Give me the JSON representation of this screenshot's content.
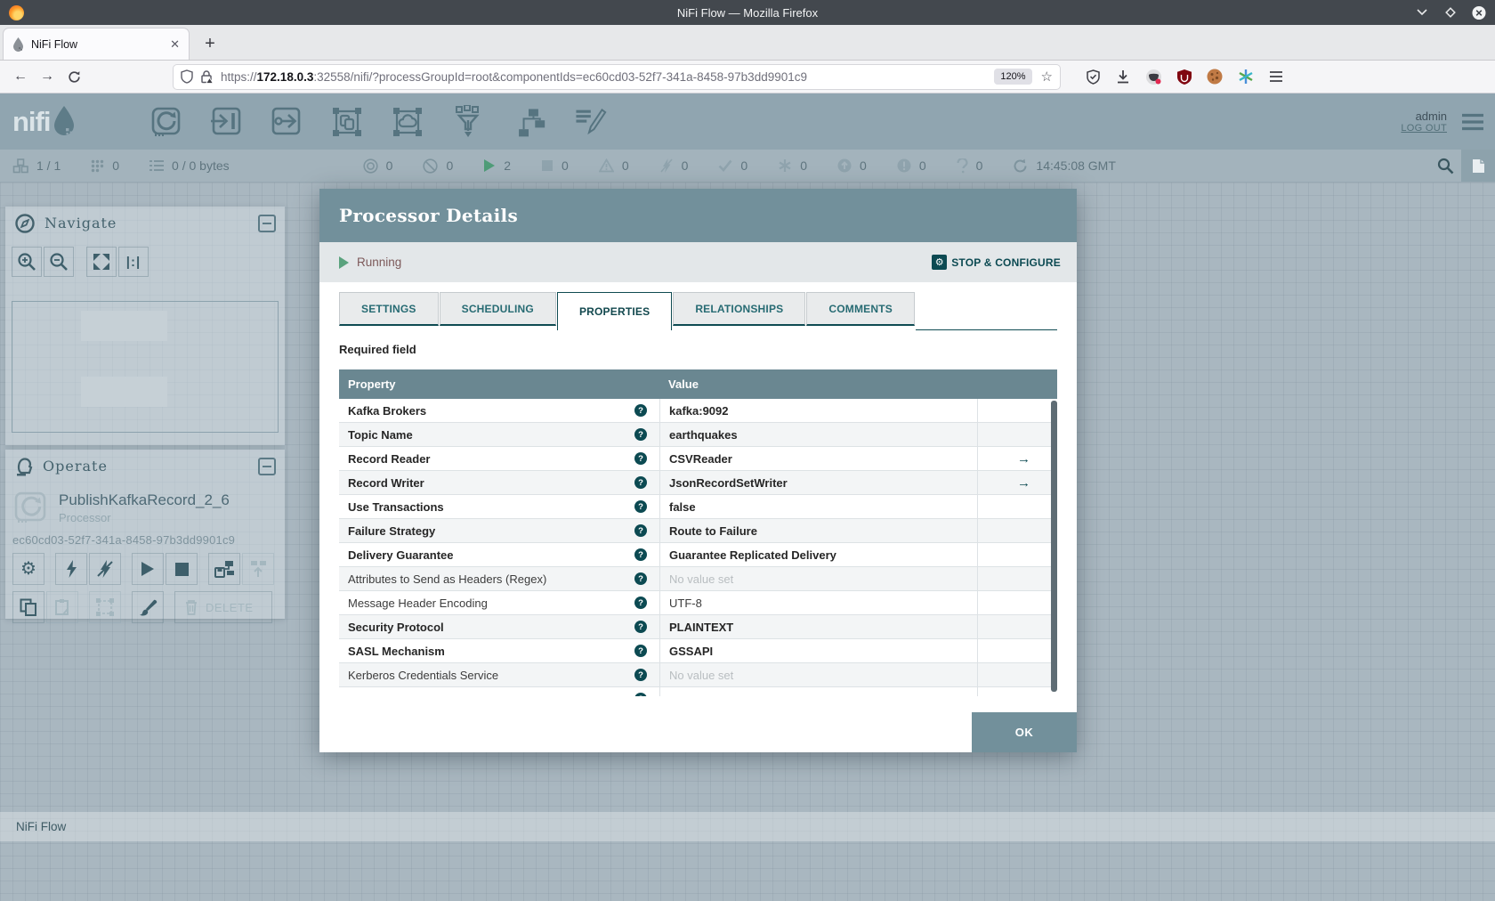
{
  "browser": {
    "window_title": "NiFi Flow — Mozilla Firefox",
    "tab_title": "NiFi Flow",
    "close_tab_glyph": "✕",
    "new_tab_glyph": "+",
    "back_glyph": "←",
    "forward_glyph": "→",
    "url_scheme": "https://",
    "url_host": "172.18.0.3",
    "url_rest": ":32558/nifi/?processGroupId=root&componentIds=ec60cd03-52f7-341a-8458-97b3dd9901c9",
    "zoom_badge": "120%",
    "star_glyph": "☆"
  },
  "app_header": {
    "logo_text": "nifi",
    "user": "admin",
    "logout_label": "LOG OUT"
  },
  "status_bar": {
    "items": [
      {
        "icon": "cluster-icon",
        "value": "1 / 1"
      },
      {
        "icon": "port-grid-icon",
        "value": "0"
      },
      {
        "icon": "queued-icon",
        "value": "0 / 0 bytes"
      },
      {
        "icon": "transmitting-icon",
        "value": "0"
      },
      {
        "icon": "not-transmitting-icon",
        "value": "0"
      },
      {
        "icon": "running-icon",
        "value": "2"
      },
      {
        "icon": "stopped-icon",
        "value": "0"
      },
      {
        "icon": "invalid-icon",
        "value": "0"
      },
      {
        "icon": "disabled-icon",
        "value": "0"
      },
      {
        "icon": "up-to-date-icon",
        "value": "0"
      },
      {
        "icon": "locally-modified-icon",
        "value": "0"
      },
      {
        "icon": "stale-icon",
        "value": "0"
      },
      {
        "icon": "locally-modified-stale-icon",
        "value": "0"
      },
      {
        "icon": "sync-failure-icon",
        "value": "0"
      }
    ],
    "refresh_time": "14:45:08 GMT"
  },
  "navigate_panel": {
    "title": "Navigate",
    "one_to_one_label": "|:|"
  },
  "operate_panel": {
    "title": "Operate",
    "component_name": "PublishKafkaRecord_2_6",
    "component_type": "Processor",
    "component_id": "ec60cd03-52f7-341a-8458-97b3dd9901c9",
    "gear_glyph": "⚙",
    "delete_label": "DELETE"
  },
  "dialog": {
    "title": "Processor Details",
    "status_label": "Running",
    "action_label": "STOP & CONFIGURE",
    "action_gear_glyph": "⚙",
    "tabs": [
      {
        "label": "SETTINGS"
      },
      {
        "label": "SCHEDULING"
      },
      {
        "label": "PROPERTIES"
      },
      {
        "label": "RELATIONSHIPS"
      },
      {
        "label": "COMMENTS"
      }
    ],
    "required_note": "Required field",
    "table": {
      "col_property": "Property",
      "col_value": "Value",
      "help_glyph": "?",
      "goto_glyph": "→",
      "rows": [
        {
          "name": "Kafka Brokers",
          "value": "kafka:9092",
          "required": true
        },
        {
          "name": "Topic Name",
          "value": "earthquakes",
          "required": true
        },
        {
          "name": "Record Reader",
          "value": "CSVReader",
          "required": true,
          "link": true
        },
        {
          "name": "Record Writer",
          "value": "JsonRecordSetWriter",
          "required": true,
          "link": true
        },
        {
          "name": "Use Transactions",
          "value": "false",
          "required": true
        },
        {
          "name": "Failure Strategy",
          "value": "Route to Failure",
          "required": true
        },
        {
          "name": "Delivery Guarantee",
          "value": "Guarantee Replicated Delivery",
          "required": true
        },
        {
          "name": "Attributes to Send as Headers (Regex)",
          "value": "No value set",
          "required": false,
          "unset": true
        },
        {
          "name": "Message Header Encoding",
          "value": "UTF-8",
          "required": false
        },
        {
          "name": "Security Protocol",
          "value": "PLAINTEXT",
          "required": true
        },
        {
          "name": "SASL Mechanism",
          "value": "GSSAPI",
          "required": true
        },
        {
          "name": "Kerberos Credentials Service",
          "value": "No value set",
          "required": false,
          "unset": true
        }
      ]
    },
    "ok_label": "OK"
  },
  "breadcrumb": {
    "label": "NiFi Flow"
  },
  "colors": {
    "accent_teal": "#0c4a52",
    "running_green": "#5aa27d",
    "dialog_header": "#72909b",
    "table_header": "#6a8791",
    "canvas": "#a9b7c0"
  }
}
